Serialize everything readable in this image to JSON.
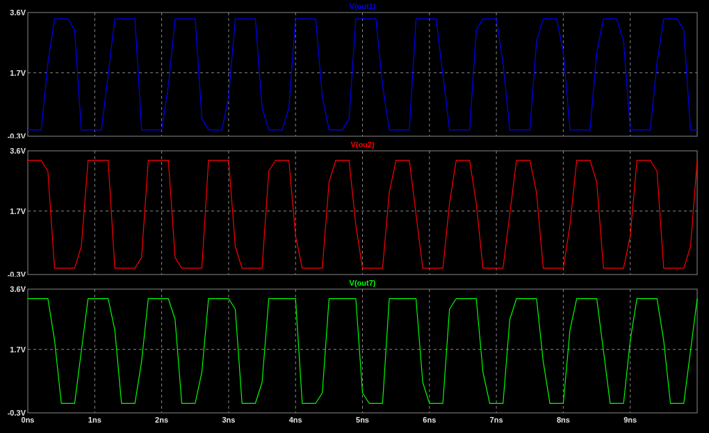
{
  "panes": [
    {
      "chart_data": {
        "type": "line",
        "x": [
          0,
          0.1,
          0.2,
          0.3,
          0.4,
          0.5,
          0.6,
          0.7,
          0.8,
          0.9,
          1,
          1.1,
          1.2,
          1.3,
          1.4,
          1.5,
          1.6,
          1.7,
          1.8,
          1.9,
          2,
          2.1,
          2.2,
          2.3,
          2.4,
          2.5,
          2.6,
          2.7,
          2.8,
          2.9,
          3,
          3.1,
          3.2,
          3.3,
          3.4,
          3.5,
          3.6,
          3.7,
          3.8,
          3.9,
          4,
          4.1,
          4.2,
          4.3,
          4.4,
          4.5,
          4.6,
          4.7,
          4.8,
          4.9,
          5,
          5.1,
          5.2,
          5.3,
          5.4,
          5.5,
          5.6,
          5.7,
          5.8,
          5.9,
          6,
          6.1,
          6.2,
          6.3,
          6.4,
          6.5,
          6.6,
          6.7,
          6.8,
          6.9,
          7,
          7.1,
          7.2,
          7.3,
          7.4,
          7.5,
          7.6,
          7.7,
          7.8,
          7.9,
          8,
          8.1,
          8.2,
          8.3,
          8.4,
          8.5,
          8.6,
          8.7,
          8.8,
          8.9,
          9,
          9.1,
          9.2,
          9.3,
          9.4,
          9.5,
          9.6,
          9.7,
          9.8,
          9.9,
          10
        ],
        "series": [
          {
            "name": "V(out1)",
            "color": "#0000ff",
            "values": [
              -0.1,
              -0.1,
              -0.1,
              2.0,
              3.4,
              3.4,
              3.4,
              3.05,
              -0.1,
              -0.1,
              -0.1,
              -0.1,
              1.65,
              3.4,
              3.4,
              3.4,
              3.4,
              -0.1,
              -0.1,
              -0.1,
              -0.1,
              1.3,
              3.4,
              3.4,
              3.4,
              3.4,
              0.25,
              -0.1,
              -0.1,
              -0.1,
              0.95,
              3.4,
              3.4,
              3.4,
              3.4,
              0.6,
              -0.1,
              -0.1,
              -0.1,
              0.6,
              3.4,
              3.4,
              3.4,
              3.4,
              0.95,
              -0.1,
              -0.1,
              -0.1,
              0.25,
              3.4,
              3.4,
              3.4,
              3.4,
              1.3,
              -0.1,
              -0.1,
              -0.1,
              -0.1,
              3.4,
              3.4,
              3.4,
              3.4,
              1.65,
              -0.1,
              -0.1,
              -0.1,
              -0.1,
              3.05,
              3.4,
              3.4,
              3.4,
              2.0,
              -0.1,
              -0.1,
              -0.1,
              -0.1,
              2.7,
              3.4,
              3.4,
              3.4,
              2.35,
              -0.1,
              -0.1,
              -0.1,
              -0.1,
              2.35,
              3.4,
              3.4,
              3.4,
              2.7,
              -0.1,
              -0.1,
              -0.1,
              -0.1,
              2.0,
              3.4,
              3.4,
              3.4,
              3.05,
              -0.1,
              -0.1
            ]
          }
        ],
        "xlim": [
          0,
          10
        ],
        "ylim": [
          -0.3,
          3.6
        ],
        "grid": true,
        "yticks": [
          {
            "value": -0.3,
            "label": "-0.3V"
          },
          {
            "value": 1.7,
            "label": "1.7V"
          },
          {
            "value": 3.6,
            "label": "3.6V"
          }
        ]
      }
    },
    {
      "chart_data": {
        "type": "line",
        "x": [
          0,
          0.1,
          0.2,
          0.3,
          0.4,
          0.5,
          0.6,
          0.7,
          0.8,
          0.9,
          1,
          1.1,
          1.2,
          1.3,
          1.4,
          1.5,
          1.6,
          1.7,
          1.8,
          1.9,
          2,
          2.1,
          2.2,
          2.3,
          2.4,
          2.5,
          2.6,
          2.7,
          2.8,
          2.9,
          3,
          3.1,
          3.2,
          3.3,
          3.4,
          3.5,
          3.6,
          3.7,
          3.8,
          3.9,
          4,
          4.1,
          4.2,
          4.3,
          4.4,
          4.5,
          4.6,
          4.7,
          4.8,
          4.9,
          5,
          5.1,
          5.2,
          5.3,
          5.4,
          5.5,
          5.6,
          5.7,
          5.8,
          5.9,
          6,
          6.1,
          6.2,
          6.3,
          6.4,
          6.5,
          6.6,
          6.7,
          6.8,
          6.9,
          7,
          7.1,
          7.2,
          7.3,
          7.4,
          7.5,
          7.6,
          7.7,
          7.8,
          7.9,
          8,
          8.1,
          8.2,
          8.3,
          8.4,
          8.5,
          8.6,
          8.7,
          8.8,
          8.9,
          9,
          9.1,
          9.2,
          9.3,
          9.4,
          9.5,
          9.6,
          9.7,
          9.8,
          9.9,
          10
        ],
        "series": [
          {
            "name": "V(ou2)",
            "color": "#ff0000",
            "values": [
              3.3,
              3.3,
              3.3,
              2.96,
              -0.1,
              -0.1,
              -0.1,
              -0.1,
              0.58,
              3.3,
              3.3,
              3.3,
              3.3,
              -0.1,
              -0.1,
              -0.1,
              -0.1,
              0.24,
              3.3,
              3.3,
              3.3,
              3.3,
              0.24,
              -0.1,
              -0.1,
              -0.1,
              -0.1,
              3.3,
              3.3,
              3.3,
              3.3,
              0.58,
              -0.1,
              -0.1,
              -0.1,
              -0.1,
              2.96,
              3.3,
              3.3,
              3.3,
              0.92,
              -0.1,
              -0.1,
              -0.1,
              -0.1,
              2.62,
              3.3,
              3.3,
              3.3,
              1.26,
              -0.1,
              -0.1,
              -0.1,
              -0.1,
              2.28,
              3.3,
              3.3,
              3.3,
              1.6,
              -0.1,
              -0.1,
              -0.1,
              -0.1,
              1.94,
              3.3,
              3.3,
              3.3,
              1.94,
              -0.1,
              -0.1,
              -0.1,
              -0.1,
              1.6,
              3.3,
              3.3,
              3.3,
              2.28,
              -0.1,
              -0.1,
              -0.1,
              -0.1,
              1.26,
              3.3,
              3.3,
              3.3,
              2.62,
              -0.1,
              -0.1,
              -0.1,
              -0.1,
              0.92,
              3.3,
              3.3,
              3.3,
              2.96,
              -0.1,
              -0.1,
              -0.1,
              -0.1,
              0.58,
              3.3
            ]
          }
        ],
        "xlim": [
          0,
          10
        ],
        "ylim": [
          -0.3,
          3.6
        ],
        "grid": true,
        "yticks": [
          {
            "value": -0.3,
            "label": "-0.3V"
          },
          {
            "value": 1.7,
            "label": "1.7V"
          },
          {
            "value": 3.6,
            "label": "3.6V"
          }
        ]
      }
    },
    {
      "chart_data": {
        "type": "line",
        "x": [
          0,
          0.1,
          0.2,
          0.3,
          0.4,
          0.5,
          0.6,
          0.7,
          0.8,
          0.9,
          1,
          1.1,
          1.2,
          1.3,
          1.4,
          1.5,
          1.6,
          1.7,
          1.8,
          1.9,
          2,
          2.1,
          2.2,
          2.3,
          2.4,
          2.5,
          2.6,
          2.7,
          2.8,
          2.9,
          3,
          3.1,
          3.2,
          3.3,
          3.4,
          3.5,
          3.6,
          3.7,
          3.8,
          3.9,
          4,
          4.1,
          4.2,
          4.3,
          4.4,
          4.5,
          4.6,
          4.7,
          4.8,
          4.9,
          5,
          5.1,
          5.2,
          5.3,
          5.4,
          5.5,
          5.6,
          5.7,
          5.8,
          5.9,
          6,
          6.1,
          6.2,
          6.3,
          6.4,
          6.5,
          6.6,
          6.7,
          6.8,
          6.9,
          7,
          7.1,
          7.2,
          7.3,
          7.4,
          7.5,
          7.6,
          7.7,
          7.8,
          7.9,
          8,
          8.1,
          8.2,
          8.3,
          8.4,
          8.5,
          8.6,
          8.7,
          8.8,
          8.9,
          9,
          9.1,
          9.2,
          9.3,
          9.4,
          9.5,
          9.6,
          9.7,
          9.8,
          9.9,
          10
        ],
        "series": [
          {
            "name": "V(out7)",
            "color": "#00ff00",
            "values": [
              3.3,
              3.3,
              3.3,
              3.3,
              1.98,
              0,
              0,
              0,
              1.65,
              3.3,
              3.3,
              3.3,
              3.3,
              2.31,
              0,
              0,
              0,
              1.32,
              3.3,
              3.3,
              3.3,
              3.3,
              2.64,
              0,
              0,
              0,
              0.99,
              3.3,
              3.3,
              3.3,
              3.3,
              2.97,
              0,
              0,
              0,
              0.66,
              3.3,
              3.3,
              3.3,
              3.3,
              3.3,
              0,
              0,
              0,
              0.33,
              3.3,
              3.3,
              3.3,
              3.3,
              3.3,
              0.33,
              0,
              0,
              0,
              3.3,
              3.3,
              3.3,
              3.3,
              3.3,
              0.66,
              0,
              0,
              0,
              2.97,
              3.3,
              3.3,
              3.3,
              3.3,
              0.99,
              0,
              0,
              0,
              2.64,
              3.3,
              3.3,
              3.3,
              3.3,
              1.32,
              0,
              0,
              0,
              2.31,
              3.3,
              3.3,
              3.3,
              3.3,
              1.65,
              0,
              0,
              0,
              1.98,
              3.3,
              3.3,
              3.3,
              3.3,
              1.98,
              0,
              0,
              0,
              1.65,
              3.3
            ]
          }
        ],
        "xlim": [
          0,
          10
        ],
        "ylim": [
          -0.3,
          3.6
        ],
        "grid": true,
        "xticks": [
          {
            "value": 0,
            "label": "0ns"
          },
          {
            "value": 1,
            "label": "1ns"
          },
          {
            "value": 2,
            "label": "2ns"
          },
          {
            "value": 3,
            "label": "3ns"
          },
          {
            "value": 4,
            "label": "4ns"
          },
          {
            "value": 5,
            "label": "5ns"
          },
          {
            "value": 6,
            "label": "6ns"
          },
          {
            "value": 7,
            "label": "7ns"
          },
          {
            "value": 8,
            "label": "8ns"
          },
          {
            "value": 9,
            "label": "9ns"
          }
        ],
        "yticks": [
          {
            "value": -0.3,
            "label": "-0.3V"
          },
          {
            "value": 1.7,
            "label": "1.7V"
          },
          {
            "value": 3.6,
            "label": "3.6V"
          }
        ]
      }
    }
  ]
}
